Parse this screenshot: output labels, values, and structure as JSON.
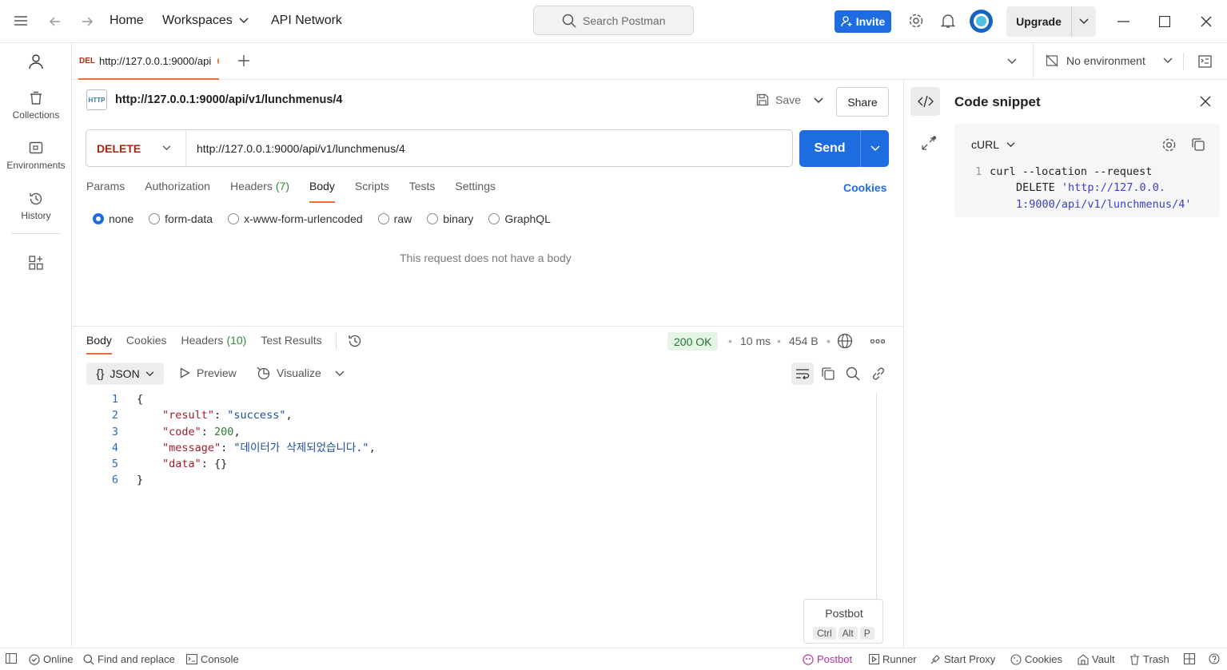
{
  "titlebar": {
    "nav": {
      "home": "Home",
      "workspaces": "Workspaces",
      "api_network": "API Network"
    },
    "search_placeholder": "Search Postman",
    "invite_label": "Invite",
    "upgrade_label": "Upgrade"
  },
  "sidebar": {
    "items": [
      {
        "label": "Collections"
      },
      {
        "label": "Environments"
      },
      {
        "label": "History"
      }
    ]
  },
  "tab": {
    "method_abbr": "DEL",
    "title": "http://127.0.0.1:9000/api"
  },
  "environment": {
    "label": "No environment"
  },
  "request": {
    "title": "http://127.0.0.1:9000/api/v1/lunchmenus/4",
    "save_label": "Save",
    "share_label": "Share",
    "method": "DELETE",
    "url": "http://127.0.0.1:9000/api/v1/lunchmenus/4",
    "send_label": "Send",
    "tabs": {
      "params": "Params",
      "authorization": "Authorization",
      "headers": "Headers",
      "headers_count": "(7)",
      "body": "Body",
      "scripts": "Scripts",
      "tests": "Tests",
      "settings": "Settings"
    },
    "cookies_label": "Cookies",
    "body_modes": [
      "none",
      "form-data",
      "x-www-form-urlencoded",
      "raw",
      "binary",
      "GraphQL"
    ],
    "selected_body_mode": "none",
    "empty_body_text": "This request does not have a body"
  },
  "response": {
    "tabs": {
      "body": "Body",
      "cookies": "Cookies",
      "headers": "Headers",
      "headers_count": "(10)",
      "test_results": "Test Results"
    },
    "status": "200 OK",
    "time": "10 ms",
    "size": "454 B",
    "format_label": "JSON",
    "preview_label": "Preview",
    "visualize_label": "Visualize",
    "code_lines": [
      {
        "n": "1",
        "text": "{"
      },
      {
        "n": "2",
        "key": "\"result\"",
        "value": "\"success\"",
        "type": "s",
        "trail": ","
      },
      {
        "n": "3",
        "key": "\"code\"",
        "value": "200",
        "type": "n",
        "trail": ","
      },
      {
        "n": "4",
        "key": "\"message\"",
        "value": "\"데이터가 삭제되었습니다.\"",
        "type": "s",
        "trail": ","
      },
      {
        "n": "5",
        "key": "\"data\"",
        "value": "{}",
        "type": "p",
        "trail": ""
      },
      {
        "n": "6",
        "text": "}"
      }
    ]
  },
  "code_snippet": {
    "title": "Code snippet",
    "language": "cURL",
    "line_no": "1",
    "line1": "curl --location --request",
    "line2_method": "DELETE",
    "line2_url": "'http://127.0.0.",
    "line3_url": "1:9000/api/v1/lunchmenus/4'"
  },
  "postbot": {
    "title": "Postbot",
    "keys": [
      "Ctrl",
      "Alt",
      "P"
    ]
  },
  "statusbar": {
    "online": "Online",
    "find_replace": "Find and replace",
    "console": "Console",
    "postbot": "Postbot",
    "runner": "Runner",
    "start_proxy": "Start Proxy",
    "cookies": "Cookies",
    "vault": "Vault",
    "trash": "Trash"
  },
  "colors": {
    "accent": "#1d6de0",
    "tab_indicator": "#f26b3a",
    "method_delete": "#a8270e",
    "status_ok": "#1f7a2e"
  }
}
